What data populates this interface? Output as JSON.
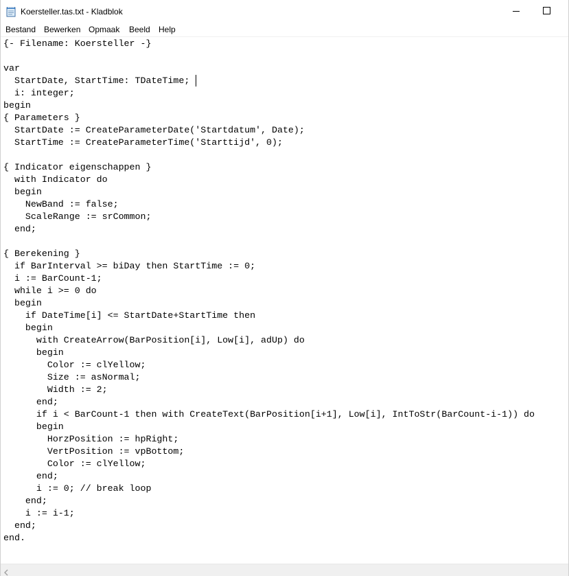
{
  "window": {
    "title": "Koersteller.tas.txt - Kladblok",
    "icons": {
      "app": "notepad-icon",
      "minimize": "minimize-icon",
      "maximize": "maximize-icon",
      "scroll_left": "scroll-left-arrow-icon"
    }
  },
  "menu": {
    "items": [
      {
        "label": "Bestand"
      },
      {
        "label": "Bewerken"
      },
      {
        "label": "Opmaak"
      },
      {
        "label": "Beeld"
      },
      {
        "label": "Help"
      }
    ]
  },
  "editor": {
    "content": "{- Filename: Koersteller -}\n\nvar\n  StartDate, StartTime: TDateTime;\n  i: integer;\nbegin\n{ Parameters }\n  StartDate := CreateParameterDate('Startdatum', Date);\n  StartTime := CreateParameterTime('Starttijd', 0);\n\n{ Indicator eigenschappen }\n  with Indicator do\n  begin\n    NewBand := false;\n    ScaleRange := srCommon;\n  end;\n\n{ Berekening }\n  if BarInterval >= biDay then StartTime := 0;\n  i := BarCount-1;\n  while i >= 0 do\n  begin\n    if DateTime[i] <= StartDate+StartTime then\n    begin\n      with CreateArrow(BarPosition[i], Low[i], adUp) do\n      begin\n        Color := clYellow;\n        Size := asNormal;\n        Width := 2;\n      end;\n      if i < BarCount-1 then with CreateText(BarPosition[i+1], Low[i], IntToStr(BarCount-i-1)) do\n      begin\n        HorzPosition := hpRight;\n        VertPosition := vpBottom;\n        Color := clYellow;\n      end;\n      i := 0; // break loop\n    end;\n    i := i-1;\n  end;\nend."
  }
}
